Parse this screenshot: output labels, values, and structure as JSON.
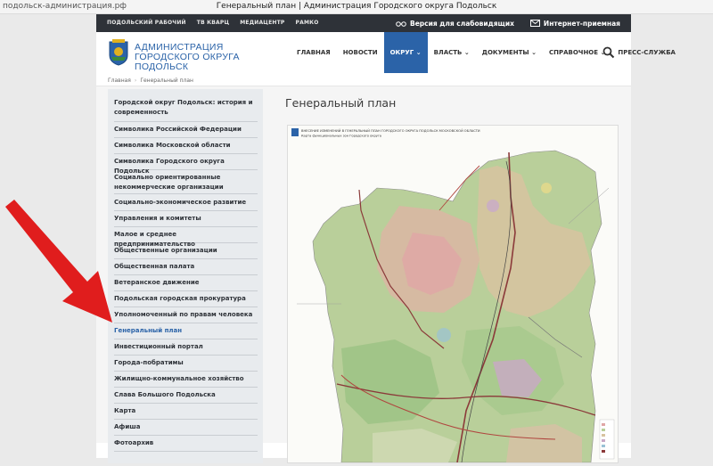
{
  "browser": {
    "url": "подольск-администрация.рф",
    "window_title": "Генеральный план | Администрация Городского округа Подольск"
  },
  "topbar": {
    "links": [
      "ПОДОЛЬСКИЙ РАБОЧИЙ",
      "ТВ КВАРЦ",
      "МЕДИАЦЕНТР",
      "РАМКО"
    ],
    "vision": "Версия для слабовидящих",
    "reception": "Интернет-приемная"
  },
  "brand": {
    "line1": "АДМИНИСТРАЦИЯ",
    "line2": "ГОРОДСКОГО ОКРУГА ПОДОЛЬСК"
  },
  "nav": {
    "items": [
      "ГЛАВНАЯ",
      "НОВОСТИ",
      "ОКРУГ",
      "ВЛАСТЬ",
      "ДОКУМЕНТЫ",
      "СПРАВОЧНОЕ",
      "ПРЕСС-СЛУЖБА"
    ],
    "active_index": 2
  },
  "breadcrumb": {
    "home": "Главная",
    "current": "Генеральный план"
  },
  "sidebar": {
    "items": [
      "Городской округ Подольск: история и современность",
      "Символика Российской Федерации",
      "Символика Московской области",
      "Символика Городского округа Подольск",
      "Социально ориентированные некоммерческие организации",
      "Социально-экономическое развитие",
      "Управления и комитеты",
      "Малое и среднее предпринимательство",
      "Общественные организации",
      "Общественная палата",
      "Ветеранское движение",
      "Подольская городская прокуратура",
      "Уполномоченный по правам человека",
      "Генеральный план",
      "Инвестиционный портал",
      "Города-побратимы",
      "Жилищно-коммунальное хозяйство",
      "Слава Большого Подольска",
      "Карта",
      "Афиша",
      "Фотоархив"
    ],
    "active_index": 13
  },
  "page": {
    "title": "Генеральный план"
  },
  "map": {
    "header_line1": "ВНЕСЕНИЕ ИЗМЕНЕНИЙ В ГЕНЕРАЛЬНЫЙ ПЛАН ГОРОДСКОГО ОКРУГА ПОДОЛЬСК МОСКОВСКОЙ ОБЛАСТИ",
    "header_line2": "Карта функциональных зон Городского округа"
  },
  "colors": {
    "accent": "#2b63a8",
    "topbar": "#2e3238",
    "arrow": "#e01d1d"
  }
}
